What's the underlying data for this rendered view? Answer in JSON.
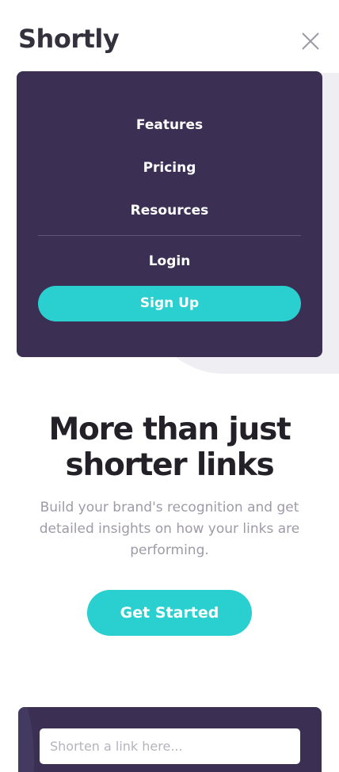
{
  "header": {
    "logo": "Shortly",
    "close_icon": "close-icon"
  },
  "menu": {
    "items": [
      {
        "label": "Features"
      },
      {
        "label": "Pricing"
      },
      {
        "label": "Resources"
      }
    ],
    "login_label": "Login",
    "signup_label": "Sign Up"
  },
  "hero": {
    "title_line1": "More than just",
    "title_line2": "shorter links",
    "description": "Build your brand's recognition and get detailed insights on how your links are performing.",
    "cta_label": "Get Started"
  },
  "shorten": {
    "placeholder": "Shorten a link here..."
  },
  "colors": {
    "primary_cyan": "#2acfcf",
    "dark_violet": "#3b3054",
    "text_dark": "#34313d",
    "text_gray": "#9e9aa7"
  }
}
